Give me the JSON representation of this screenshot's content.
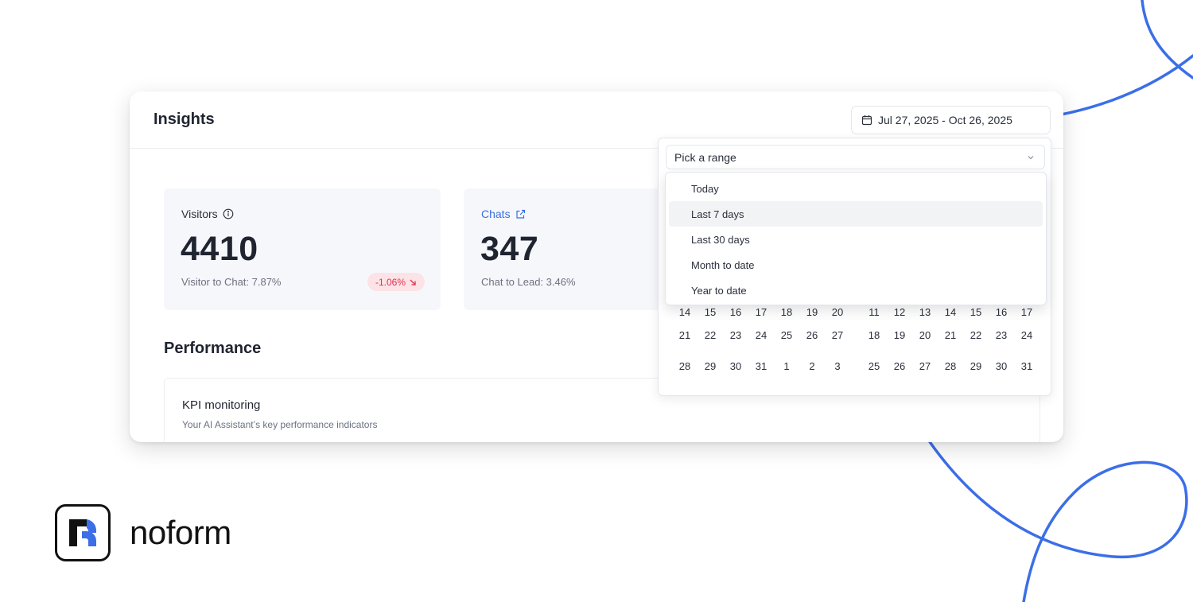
{
  "header": {
    "title": "Insights"
  },
  "date_range": {
    "value": "Jul 27, 2025 - Oct 26, 2025"
  },
  "stats": [
    {
      "label": "Visitors",
      "value": "4410",
      "sub": "Visitor to Chat: 7.87%",
      "badge": "-1.06%"
    },
    {
      "label": "Chats",
      "value": "347",
      "sub": "Chat to Lead: 3.46%"
    }
  ],
  "performance": {
    "title": "Performance",
    "kpi_title": "KPI monitoring",
    "kpi_sub": "Your AI Assistant’s key performance indicators"
  },
  "picker": {
    "placeholder": "Pick a range",
    "options": [
      "Today",
      "Last 7 days",
      "Last 30 days",
      "Month to date",
      "Year to date"
    ],
    "hovered_option": "Last 7 days",
    "left_weeks": [
      [
        "14",
        "15",
        "16",
        "17",
        "18",
        "19",
        "20"
      ],
      [
        "21",
        "22",
        "23",
        "24",
        "25",
        "26",
        "27"
      ],
      [
        "28",
        "29",
        "30",
        "31",
        "1",
        "2",
        "3"
      ]
    ],
    "right_weeks": [
      [
        "11",
        "12",
        "13",
        "14",
        "15",
        "16",
        "17"
      ],
      [
        "18",
        "19",
        "20",
        "21",
        "22",
        "23",
        "24"
      ],
      [
        "25",
        "26",
        "27",
        "28",
        "29",
        "30",
        "31"
      ]
    ]
  },
  "brand": {
    "name": "noform",
    "accent": "#3b6ee8",
    "badge_bg": "#fde2e6",
    "badge_fg": "#e0314e"
  },
  "icons": [
    "calendar-icon",
    "info-icon",
    "external-link-icon",
    "trend-down-icon",
    "chevron-down-icon",
    "noform-logo-icon"
  ]
}
